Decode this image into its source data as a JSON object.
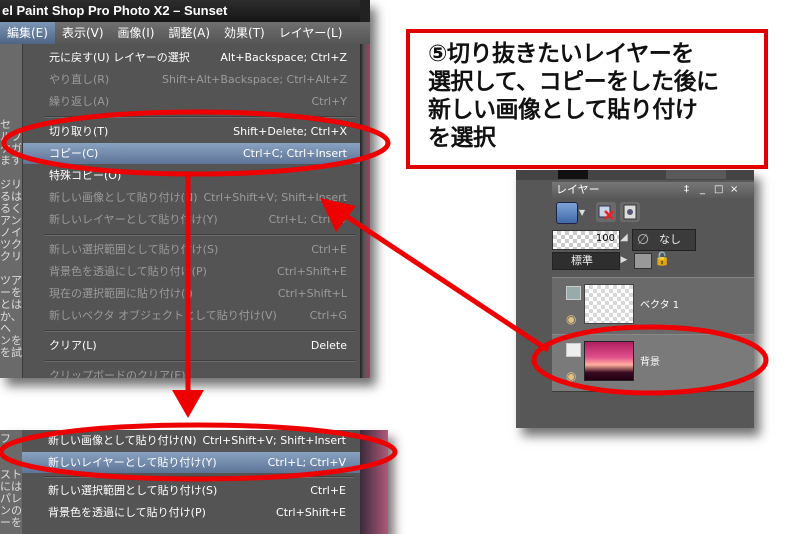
{
  "window": {
    "title": "el Paint Shop Pro Photo X2 – Sunset"
  },
  "menubar": {
    "items": [
      {
        "label": "編集(E)",
        "active": true
      },
      {
        "label": "表示(V)"
      },
      {
        "label": "画像(I)"
      },
      {
        "label": "調整(A)"
      },
      {
        "label": "効果(T)"
      },
      {
        "label": "レイヤー(L)"
      }
    ]
  },
  "edit_menu": {
    "items": [
      {
        "label": "元に戻す(U) レイヤーの選択",
        "shortcut": "Alt+Backspace; Ctrl+Z",
        "state": "enabled"
      },
      {
        "label": "やり直し(R)",
        "shortcut": "Shift+Alt+Backspace; Ctrl+Alt+Z",
        "state": "disabled"
      },
      {
        "label": "繰り返し(A)",
        "shortcut": "Ctrl+Y",
        "state": "disabled"
      },
      {
        "label": "切り取り(T)",
        "shortcut": "Shift+Delete; Ctrl+X",
        "state": "enabled"
      },
      {
        "label": "コピー(C)",
        "shortcut": "Ctrl+C; Ctrl+Insert",
        "state": "highlighted"
      },
      {
        "label": "特殊コピー(O)",
        "shortcut": "",
        "state": "enabled"
      },
      {
        "label": "新しい画像として貼り付け(N)",
        "shortcut": "Ctrl+Shift+V; Shift+Insert",
        "state": "disabled"
      },
      {
        "label": "新しいレイヤーとして貼り付け(Y)",
        "shortcut": "Ctrl+L; Ctrl+V",
        "state": "disabled"
      },
      {
        "label": "新しい選択範囲として貼り付け(S)",
        "shortcut": "Ctrl+E",
        "state": "disabled"
      },
      {
        "label": "背景色を透過にして貼り付け(P)",
        "shortcut": "Ctrl+Shift+E",
        "state": "disabled"
      },
      {
        "label": "現在の選択範囲に貼り付け(I)",
        "shortcut": "Ctrl+Shift+L",
        "state": "disabled"
      },
      {
        "label": "新しいベクタ オブジェクトとして貼り付け(V)",
        "shortcut": "Ctrl+G",
        "state": "disabled"
      },
      {
        "label": "クリア(L)",
        "shortcut": "Delete",
        "state": "enabled"
      },
      {
        "label": "クリップボードのクリア(E)",
        "shortcut": "",
        "state": "disabled"
      }
    ]
  },
  "edit_menu_after": {
    "items": [
      {
        "label": "新しい画像として貼り付け(N)",
        "shortcut": "Ctrl+Shift+V; Shift+Insert",
        "state": "enabled"
      },
      {
        "label": "新しいレイヤーとして貼り付け(Y)",
        "shortcut": "Ctrl+L; Ctrl+V",
        "state": "highlighted"
      },
      {
        "label": "新しい選択範囲として貼り付け(S)",
        "shortcut": "Ctrl+E",
        "state": "enabled"
      },
      {
        "label": "背景色を透過にして貼り付け(P)",
        "shortcut": "Ctrl+Shift+E",
        "state": "enabled"
      }
    ]
  },
  "left_strip_fragments": [
    "セ",
    "ルプ",
    "ケガ",
    "ます",
    "",
    "ジリ",
    "るは",
    "るく",
    "アン",
    "ノイ",
    "ツク",
    "クリ",
    "",
    "ツア",
    "ーを",
    "とは",
    "か、",
    "ヘ",
    "ンを",
    "を試"
  ],
  "left_strip_bottom": [
    "フ",
    "",
    "スト",
    "には",
    "パレ",
    "ンの",
    "ーを"
  ],
  "callout": {
    "lines": [
      "⑤切り抜きたいレイヤーを",
      "選択して、コピーをした後に",
      "新しい画像として貼り付け",
      "を選択"
    ]
  },
  "layers_panel": {
    "title": "レイヤー",
    "title_controls": [
      "‡",
      "_",
      "□",
      "×"
    ],
    "opacity": "100",
    "mask_label": "なし",
    "blend_mode": "標準",
    "layers": [
      {
        "name": "ベクタ 1",
        "type": "vector"
      },
      {
        "name": "背景",
        "type": "raster"
      }
    ]
  },
  "colors": {
    "callout_border": "#e00000",
    "annotation_red": "#ee0000",
    "menu_highlight": "#6f86a8"
  }
}
